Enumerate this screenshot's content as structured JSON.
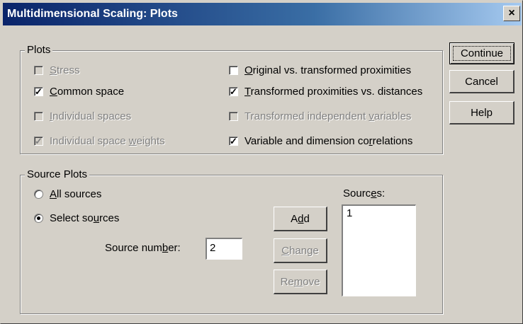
{
  "window": {
    "title": "Multidimensional Scaling: Plots",
    "close_glyph": "×"
  },
  "plots_group": {
    "legend": "Plots",
    "stress": {
      "pre": "",
      "u": "S",
      "post": "tress",
      "checked": false,
      "enabled": false
    },
    "common_space": {
      "pre": "",
      "u": "C",
      "post": "ommon space",
      "checked": true,
      "enabled": true
    },
    "individual_spaces": {
      "pre": "",
      "u": "I",
      "post": "ndividual spaces",
      "checked": false,
      "enabled": false
    },
    "individual_space_weights": {
      "pre": "Individual space ",
      "u": "w",
      "post": "eights",
      "checked": true,
      "enabled": false
    },
    "original_vs_transformed": {
      "pre": "",
      "u": "O",
      "post": "riginal vs. transformed proximities",
      "checked": false,
      "enabled": true
    },
    "transformed_vs_distances": {
      "pre": "",
      "u": "T",
      "post": "ransformed proximities vs. distances",
      "checked": true,
      "enabled": true
    },
    "transformed_independent": {
      "pre": "Transformed independent ",
      "u": "v",
      "post": "ariables",
      "checked": false,
      "enabled": false
    },
    "variable_dimension_corr": {
      "pre": "Variable and dimension co",
      "u": "r",
      "post": "relations",
      "checked": true,
      "enabled": true
    }
  },
  "source_group": {
    "legend": "Source Plots",
    "all_sources": {
      "pre": "",
      "u": "A",
      "post": "ll sources",
      "selected": false
    },
    "select_sources": {
      "pre": "Select so",
      "u": "u",
      "post": "rces",
      "selected": true
    },
    "source_number_label": {
      "pre": "Source num",
      "u": "b",
      "post": "er:"
    },
    "source_number_value": "2",
    "sources_label": {
      "pre": "Sourc",
      "u": "e",
      "post": "s:"
    },
    "sources_list": [
      "1"
    ],
    "add": {
      "pre": "A",
      "u": "d",
      "post": "d"
    },
    "change": {
      "pre": "",
      "u": "C",
      "post": "hange"
    },
    "remove": {
      "pre": "Re",
      "u": "m",
      "post": "ove"
    }
  },
  "buttons": {
    "continue": "Continue",
    "cancel": "Cancel",
    "help": "Help"
  },
  "check_glyph": "✓"
}
